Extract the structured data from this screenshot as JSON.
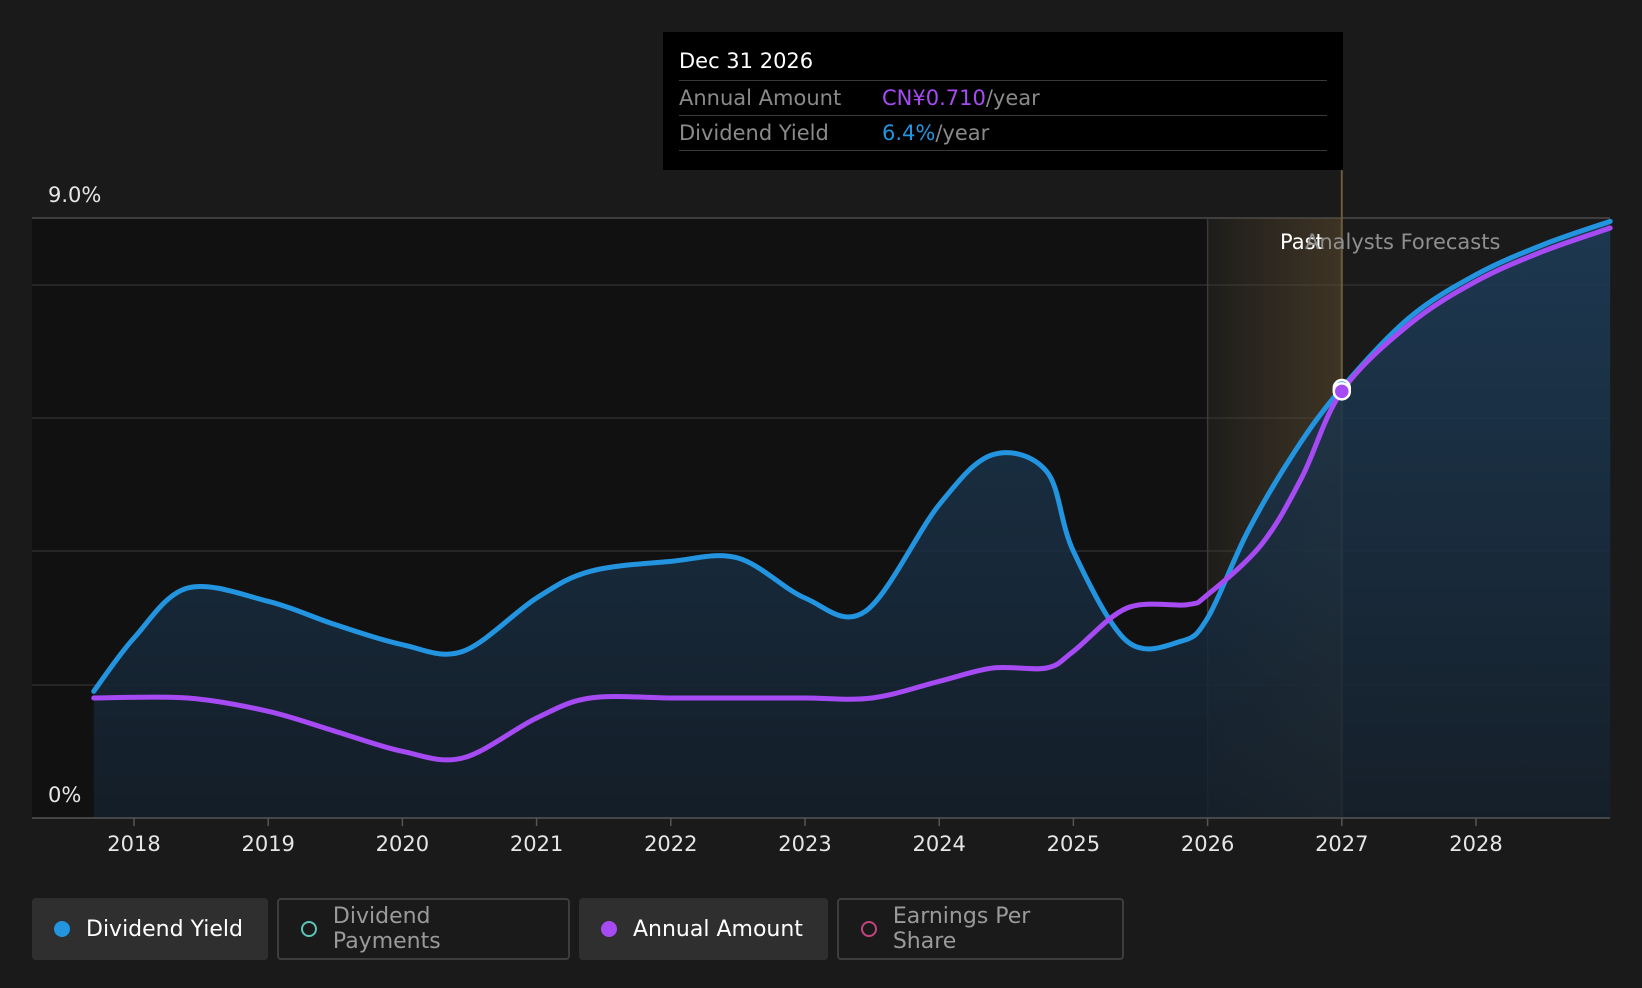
{
  "tooltip": {
    "date": "Dec 31 2026",
    "annual_amount_label": "Annual Amount",
    "annual_amount_value": "CN¥0.710",
    "dividend_yield_label": "Dividend Yield",
    "dividend_yield_value": "6.4%",
    "unit": "/year"
  },
  "regions": {
    "past_label": "Past",
    "forecast_label": "Analysts Forecasts"
  },
  "legend": [
    {
      "label": "Dividend Yield",
      "active": true,
      "color": "#2394df"
    },
    {
      "label": "Dividend Payments",
      "active": false,
      "color": "#5ec4b6"
    },
    {
      "label": "Annual Amount",
      "active": true,
      "color": "#a64bf4"
    },
    {
      "label": "Earnings Per Share",
      "active": false,
      "color": "#c0457e"
    }
  ],
  "chart_data": {
    "type": "area",
    "ylim": [
      0,
      9.0
    ],
    "xlim": [
      2017.3,
      2029.0
    ],
    "ytick_labels": [
      "0%",
      "9.0%"
    ],
    "xtick_labels": [
      "2018",
      "2019",
      "2020",
      "2021",
      "2022",
      "2023",
      "2024",
      "2025",
      "2026",
      "2027",
      "2028"
    ],
    "xticks": [
      2018,
      2019,
      2020,
      2021,
      2022,
      2023,
      2024,
      2025,
      2026,
      2027,
      2028
    ],
    "grid": true,
    "past_start": 2026.0,
    "forecast_start": 2027.0,
    "series": [
      {
        "name": "Dividend Yield",
        "color": "#2394df",
        "area": true,
        "points": [
          [
            2017.7,
            1.9
          ],
          [
            2018.0,
            2.7
          ],
          [
            2018.4,
            3.45
          ],
          [
            2019.0,
            3.25
          ],
          [
            2019.5,
            2.9
          ],
          [
            2020.0,
            2.6
          ],
          [
            2020.45,
            2.5
          ],
          [
            2021.0,
            3.3
          ],
          [
            2021.4,
            3.7
          ],
          [
            2022.0,
            3.85
          ],
          [
            2022.5,
            3.9
          ],
          [
            2023.0,
            3.3
          ],
          [
            2023.45,
            3.1
          ],
          [
            2024.0,
            4.7
          ],
          [
            2024.4,
            5.45
          ],
          [
            2024.8,
            5.2
          ],
          [
            2025.0,
            4.0
          ],
          [
            2025.4,
            2.65
          ],
          [
            2025.8,
            2.65
          ],
          [
            2026.0,
            3.0
          ],
          [
            2026.3,
            4.3
          ],
          [
            2026.65,
            5.5
          ],
          [
            2027.0,
            6.45
          ],
          [
            2027.5,
            7.5
          ],
          [
            2028.0,
            8.15
          ],
          [
            2028.5,
            8.6
          ],
          [
            2029.0,
            8.95
          ]
        ]
      },
      {
        "name": "Annual Amount",
        "color": "#a64bf4",
        "area": false,
        "points": [
          [
            2017.7,
            1.8
          ],
          [
            2018.4,
            1.8
          ],
          [
            2019.0,
            1.6
          ],
          [
            2019.5,
            1.3
          ],
          [
            2020.0,
            1.0
          ],
          [
            2020.45,
            0.9
          ],
          [
            2021.0,
            1.5
          ],
          [
            2021.4,
            1.8
          ],
          [
            2022.0,
            1.8
          ],
          [
            2022.5,
            1.8
          ],
          [
            2023.0,
            1.8
          ],
          [
            2023.5,
            1.8
          ],
          [
            2024.0,
            2.05
          ],
          [
            2024.4,
            2.25
          ],
          [
            2024.8,
            2.25
          ],
          [
            2025.0,
            2.5
          ],
          [
            2025.4,
            3.15
          ],
          [
            2025.85,
            3.2
          ],
          [
            2026.0,
            3.35
          ],
          [
            2026.4,
            4.1
          ],
          [
            2026.7,
            5.1
          ],
          [
            2027.0,
            6.4
          ],
          [
            2027.5,
            7.4
          ],
          [
            2028.0,
            8.05
          ],
          [
            2028.5,
            8.5
          ],
          [
            2029.0,
            8.85
          ]
        ]
      }
    ]
  }
}
